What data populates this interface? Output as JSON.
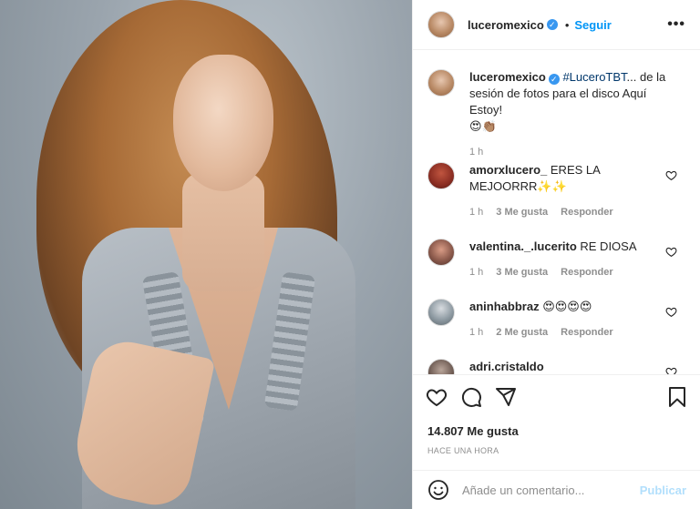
{
  "post": {
    "username": "luceromexico",
    "follow_label": "Seguir",
    "more_label": "•••",
    "verified_mark": "✓",
    "dot": "•"
  },
  "caption": {
    "username": "luceromexico",
    "hashtag": "#LuceroTBT",
    "text": "... de la sesión de fotos para el disco Aquí Estoy!",
    "emojis": "😍👏🏽",
    "time": "1 h"
  },
  "comments": [
    {
      "username": "amorxlucero_",
      "text": "ERES LA MEJOORRR✨✨",
      "time": "1 h",
      "likes": "3 Me gusta",
      "reply": "Responder"
    },
    {
      "username": "valentina._.lucerito",
      "text": "RE DIOSA",
      "time": "1 h",
      "likes": "3 Me gusta",
      "reply": "Responder"
    },
    {
      "username": "aninhabbraz",
      "text": "😍😍😍😍",
      "time": "1 h",
      "likes": "2 Me gusta",
      "reply": "Responder"
    },
    {
      "username": "adri.cristaldo",
      "text": "",
      "time": "",
      "likes": "",
      "reply": ""
    }
  ],
  "stats": {
    "likes": "14.807 Me gusta",
    "posted": "HACE UNA HORA"
  },
  "composer": {
    "placeholder": "Añade un comentario...",
    "publish": "Publicar"
  },
  "colors": {
    "accent": "#0095f6",
    "verified": "#3897f0",
    "muted": "#8e8e8e",
    "publish_disabled": "#b2dffc"
  }
}
